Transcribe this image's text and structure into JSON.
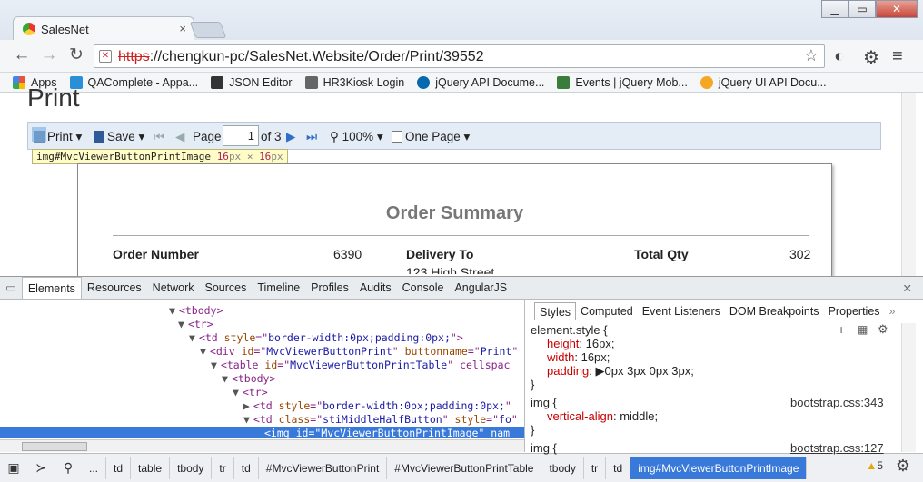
{
  "browser": {
    "tab_title": "SalesNet",
    "tab_close": "×",
    "window_buttons": [
      "▁",
      "▭",
      "✕"
    ],
    "url_scheme": "https",
    "url_rest": "://chengkun-pc/SalesNet.Website/Order/Print/39552",
    "bookmarks": [
      {
        "label": "Apps",
        "color": "#e8533d"
      },
      {
        "label": "QAComplete - Appa...",
        "color": "#2a8fd7"
      },
      {
        "label": "JSON Editor",
        "color": "#333333"
      },
      {
        "label": "HR3Kiosk Login",
        "color": "#555555"
      },
      {
        "label": "jQuery API Docume...",
        "color": "#0769ad"
      },
      {
        "label": "Events | jQuery Mob...",
        "color": "#3a7d3a"
      },
      {
        "label": "jQuery UI API Docu...",
        "color": "#f5a623"
      }
    ]
  },
  "page": {
    "title": "Print",
    "viewer": {
      "print": "Print",
      "save": "Save",
      "page_label": "Page",
      "page_value": "1",
      "of_pages": "of 3",
      "zoom": "100%",
      "view_mode": "One Page"
    },
    "tooltip": {
      "selector": "img#MvcViewerButtonPrintImage",
      "w": "16",
      "h": "16",
      "unit": "px",
      "x": "×"
    },
    "report": {
      "title": "Order Summary",
      "order_number_label": "Order Number",
      "order_number": "6390",
      "delivery_label": "Delivery To",
      "delivery_line": "123 High Street",
      "total_qty_label": "Total Qty",
      "total_qty": "302"
    }
  },
  "devtools": {
    "tabs": [
      "Elements",
      "Resources",
      "Network",
      "Sources",
      "Timeline",
      "Profiles",
      "Audits",
      "Console",
      "AngularJS"
    ],
    "dom_lines": [
      {
        "indent": 186,
        "tri": "▼",
        "html": "<tbody>"
      },
      {
        "indent": 196,
        "tri": "▼",
        "html": "<tr>"
      },
      {
        "indent": 208,
        "tri": "▼",
        "html": "<td style=\"border-width:0px;padding:0px;\">"
      },
      {
        "indent": 220,
        "tri": "▼",
        "html": "<div id=\"MvcViewerButtonPrint\" buttonname=\"Print"
      },
      {
        "indent": 232,
        "tri": "▼",
        "html": "<table id=\"MvcViewerButtonPrintTable\" cellspac"
      },
      {
        "indent": 244,
        "tri": "▼",
        "html": "<tbody>"
      },
      {
        "indent": 256,
        "tri": "▼",
        "html": "<tr>"
      },
      {
        "indent": 268,
        "tri": "▶",
        "html": "<td style=\"border-width:0px;padding:0px;\""
      },
      {
        "indent": 268,
        "tri": "▼",
        "html": "<td class=\"stiMiddleHalfButton\" style=\"fo"
      },
      {
        "indent": 291,
        "tri": "",
        "html": "<img id=\"MvcViewerButtonPrintImage\" nam"
      }
    ],
    "styles_tabs": [
      "Styles",
      "Computed",
      "Event Listeners",
      "DOM Breakpoints",
      "Properties",
      "»"
    ],
    "rules": [
      {
        "selector": "element.style {",
        "source": "",
        "props": [
          [
            "height",
            "16px;"
          ],
          [
            "width",
            "16px;"
          ],
          [
            "padding",
            "▶0px 3px 0px 3px;"
          ]
        ]
      },
      {
        "selector": "img {",
        "source": "bootstrap.css:343",
        "props": [
          [
            "vertical-align",
            "middle;"
          ]
        ]
      },
      {
        "selector": "img {",
        "source": "bootstrap.css:127",
        "props": []
      }
    ],
    "breadcrumbs": [
      "...",
      "td",
      "table",
      "tbody",
      "tr",
      "td",
      "#MvcViewerButtonPrint",
      "#MvcViewerButtonPrintTable",
      "tbody",
      "tr",
      "td",
      "img#MvcViewerButtonPrintImage"
    ],
    "warnings": "5"
  }
}
